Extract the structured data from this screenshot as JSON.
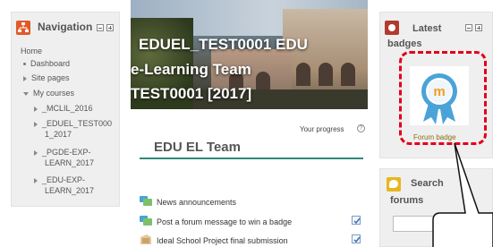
{
  "navigation": {
    "title": "Navigation",
    "items": [
      {
        "label": "Home"
      },
      {
        "label": "Dashboard"
      },
      {
        "label": "Site pages"
      },
      {
        "label": "My courses"
      },
      {
        "label": "_MCLIL_2016"
      },
      {
        "label": "_EDUEL_TEST000"
      },
      {
        "label": "1_2017"
      },
      {
        "label": "_PGDE-EXP-"
      },
      {
        "label": "LEARN_2017"
      },
      {
        "label": "_EDU-EXP-"
      },
      {
        "label": "LEARN_2017"
      }
    ]
  },
  "banner": {
    "line1": "EDUEL_TEST0001 EDU",
    "line2": "e-Learning Team",
    "line3": "TEST0001 [2017]"
  },
  "progress_label": "Your progress",
  "course_name": "EDU EL Team",
  "activities": [
    {
      "label": "News announcements",
      "icon": "forum-icon",
      "completed": false
    },
    {
      "label": "Post a forum message to win a badge",
      "icon": "forum-icon",
      "completed": true
    },
    {
      "label": "Ideal School Project final submission",
      "icon": "assignment-icon",
      "completed": true
    }
  ],
  "latest_badges": {
    "title_line1": "Latest",
    "title_line2": "badges",
    "badge_name": "Forum badge",
    "highlight_color": "#e2001a"
  },
  "search_forums": {
    "title_line1": "Search",
    "title_line2": "forums",
    "placeholder": ""
  },
  "colors": {
    "accent": "#2e8b7a",
    "navigation_icon": "#e05a28",
    "badge_blue": "#4aa3d8"
  }
}
